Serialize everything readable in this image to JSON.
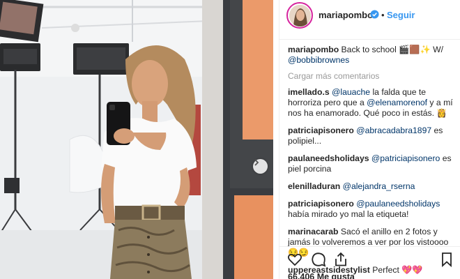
{
  "header": {
    "username": "mariapombo",
    "follow_label": "Seguir",
    "separator": "•"
  },
  "comments": [
    {
      "user": "mariapombo",
      "parts": [
        "Back to school 🎬🟫✨ W/ ",
        "@bobbibrownes"
      ]
    },
    {
      "user": "imellado.s",
      "parts": [
        "@lauache",
        " la falda que te horroriza pero que a ",
        "@elenamorenof",
        " y a mí nos ha enamorado. Qué poco in estás. 👸"
      ]
    },
    {
      "user": "patriciapisonero",
      "parts": [
        "@abracadabra1897",
        " es polipiel..."
      ]
    },
    {
      "user": "paulaneedsholidays",
      "parts": [
        "@patriciapisonero",
        " es piel porcina"
      ]
    },
    {
      "user": "elenilladuran",
      "parts": [
        "@alejandra_rserna"
      ]
    },
    {
      "user": "patriciapisonero",
      "parts": [
        "@paulaneedsholidays",
        " había mirado yo mal la etiqueta!"
      ]
    },
    {
      "user": "marinacarab",
      "parts": [
        "Sacó el anillo en 2 fotos y jamás lo volveremos a ver por los vistoooo 😏😏"
      ]
    },
    {
      "user": "uppereastsidestylist",
      "parts": [
        "Perfect 💖💖"
      ]
    }
  ],
  "load_more_label": "Cargar más comentarios",
  "likes_label": "66.406 Me gusta",
  "icons": {
    "verified": "verified-badge-icon",
    "like": "heart-icon",
    "comment": "comment-bubble-icon",
    "share": "share-icon",
    "save": "bookmark-icon",
    "next": "chevron-right-icon"
  },
  "colors": {
    "accent": "#3897f0",
    "mention": "#003569",
    "muted": "#999999",
    "text": "#262626"
  }
}
